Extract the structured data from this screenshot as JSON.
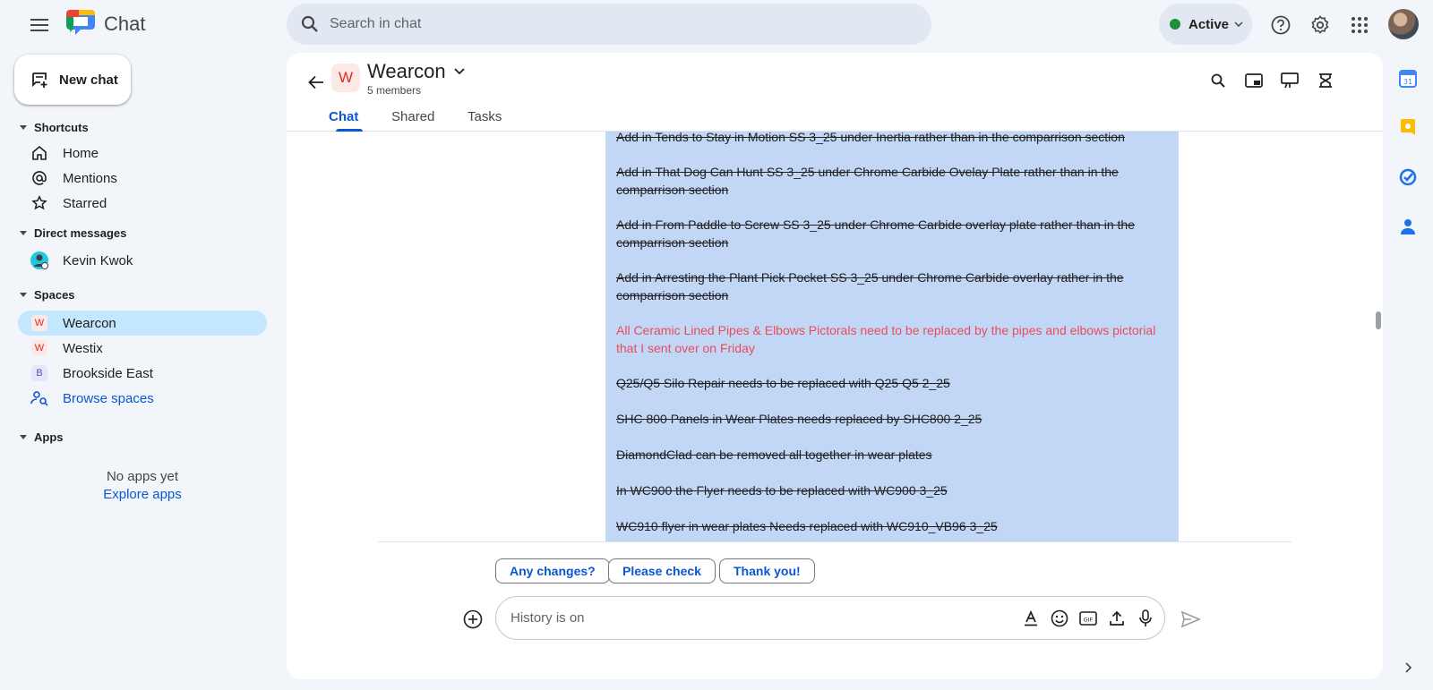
{
  "app": {
    "name": "Chat"
  },
  "search": {
    "placeholder": "Search in chat"
  },
  "status": {
    "label": "Active",
    "color": "#1e8e3e"
  },
  "sidebar": {
    "new_chat_label": "New chat",
    "shortcuts": {
      "heading": "Shortcuts",
      "items": [
        {
          "label": "Home",
          "icon": "home-icon"
        },
        {
          "label": "Mentions",
          "icon": "at-icon"
        },
        {
          "label": "Starred",
          "icon": "star-icon"
        }
      ]
    },
    "direct_messages": {
      "heading": "Direct messages",
      "items": [
        {
          "label": "Kevin Kwok",
          "icon": "avatar"
        }
      ]
    },
    "spaces": {
      "heading": "Spaces",
      "items": [
        {
          "label": "Wearcon",
          "initial": "W",
          "selected": true
        },
        {
          "label": "Westix",
          "initial": "W"
        },
        {
          "label": "Brookside East",
          "initial": "B"
        },
        {
          "label": "Browse spaces",
          "icon": "browse-spaces-icon"
        }
      ]
    },
    "apps": {
      "heading": "Apps",
      "empty_text": "No apps yet",
      "explore_label": "Explore apps"
    }
  },
  "space": {
    "initial": "W",
    "name": "Wearcon",
    "members": "5 members",
    "tabs": [
      {
        "label": "Chat"
      },
      {
        "label": "Shared"
      },
      {
        "label": "Tasks"
      }
    ]
  },
  "messages": [
    {
      "text": "Add in Tends to Stay in Motion SS 3_25 under Inertia rather than in the comparrison section",
      "style": "strike"
    },
    {
      "text": "Add in That Dog Can Hunt SS 3_25 under Chrome Carbide Ovelay Plate rather than in the comparrison section",
      "style": "strike"
    },
    {
      "text": "Add in From Paddle to Screw SS 3_25 under Chrome Carbide overlay plate rather than in the comparrison section",
      "style": "strike"
    },
    {
      "text": "Add in Arresting the Plant Pick Pocket SS 3_25 under Chrome Carbide overlay rather in the comparrison section",
      "style": "strike"
    },
    {
      "text": "All Ceramic Lined Pipes & Elbows Pictorals need to be replaced by the pipes and elbows pictorial that I sent over on Friday",
      "style": "red"
    },
    {
      "text": "Q25/Q5 Silo Repair needs to be replaced with Q25 Q5 2_25",
      "style": "strike"
    },
    {
      "text": "SHC 800 Panels in Wear Plates needs replaced by SHC800 2_25",
      "style": "strike"
    },
    {
      "text": "DiamondClad can be removed all together in wear plates",
      "style": "strike"
    },
    {
      "text": "In WC900 the Flyer needs to be replaced with WC900 3_25",
      "style": "strike"
    },
    {
      "text": "WC910 flyer in wear plates Needs replaced with WC910_VB96 3_25",
      "style": "strike"
    }
  ],
  "quick_replies": [
    "Any changes?",
    "Please check",
    "Thank you!"
  ],
  "composer": {
    "placeholder": "History is on"
  },
  "colors": {
    "accent": "#0b57d0",
    "selection": "#c2d7f6",
    "highlight_text": "#e94d5a",
    "selected_nav": "#c2e7ff"
  }
}
